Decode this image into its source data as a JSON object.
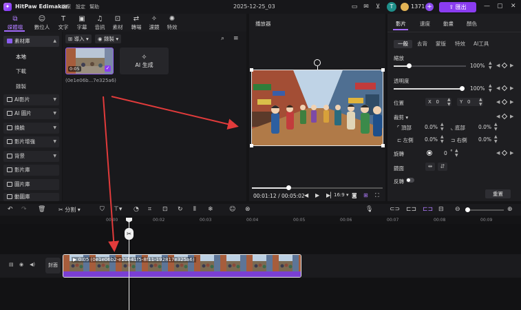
{
  "titlebar": {
    "app_name": "HitPaw Edimakor",
    "menu": [
      "檔案",
      "設定",
      "幫助"
    ],
    "date": "2025-12-25_03",
    "avatar_letter": "T",
    "coins": "1371",
    "export_label": "匯出"
  },
  "tools": [
    {
      "label": "媒體檔案",
      "icon": "media-icon"
    },
    {
      "label": "數位人",
      "icon": "avatar-icon"
    },
    {
      "label": "文字",
      "icon": "text-icon"
    },
    {
      "label": "字幕",
      "icon": "subtitle-icon"
    },
    {
      "label": "音訊",
      "icon": "audio-icon"
    },
    {
      "label": "素材",
      "icon": "asset-icon"
    },
    {
      "label": "轉場",
      "icon": "transition-icon"
    },
    {
      "label": "濾鏡",
      "icon": "filter-icon"
    },
    {
      "label": "特效",
      "icon": "effect-icon"
    }
  ],
  "sidebar": {
    "library_label": "素材庫",
    "library_sub": [
      "本地",
      "下載",
      "錄製"
    ],
    "items": [
      "AI影片",
      "AI 圖片",
      "換臉",
      "影片增強",
      "背景",
      "影片庫",
      "圖片庫",
      "動圖庫"
    ]
  },
  "media": {
    "import_label": "導入",
    "record_label": "錄製",
    "thumb_time": "0:05",
    "thumb_name": "(0e1e06b...7e325a6)",
    "ai_gen_label": "AI 生成"
  },
  "player": {
    "title": "播放器",
    "current_time": "00:01:12",
    "total_time": "00:05:02",
    "aspect": "16:9",
    "progress": 0.28
  },
  "props": {
    "tabs": [
      "影片",
      "速度",
      "動畫",
      "顏色"
    ],
    "subtabs": [
      "一般",
      "去背",
      "蒙版",
      "特效",
      "AI工具"
    ],
    "scale_label": "縮放",
    "scale_value": "100%",
    "opacity_label": "透明度",
    "opacity_value": "100%",
    "position_label": "位置",
    "pos_x_label": "X",
    "pos_x": "0",
    "pos_y_label": "Y",
    "pos_y": "0",
    "crop_label": "裁剪",
    "crop_top_label": "頂部",
    "crop_top": "0.0%",
    "crop_bottom_label": "底部",
    "crop_bottom": "0.0%",
    "crop_left_label": "左側",
    "crop_left": "0.0%",
    "crop_right_label": "右側",
    "crop_right": "0.0%",
    "rotate_label": "旋轉",
    "rotate_value": "0",
    "rotate_unit": "°",
    "mirror_label": "鏡面",
    "reverse_label": "反轉",
    "reset_label": "重置"
  },
  "timeline": {
    "split_label": "分割",
    "ticks": [
      "00:00",
      "00:02",
      "00:03",
      "00:04",
      "00:05",
      "00:06",
      "00:07",
      "00:08",
      "00:09"
    ],
    "cover_label": "封面",
    "clip_label": "0:05  (0e1e06b2-e20f-41f5-8f11-192817e325a6)"
  }
}
